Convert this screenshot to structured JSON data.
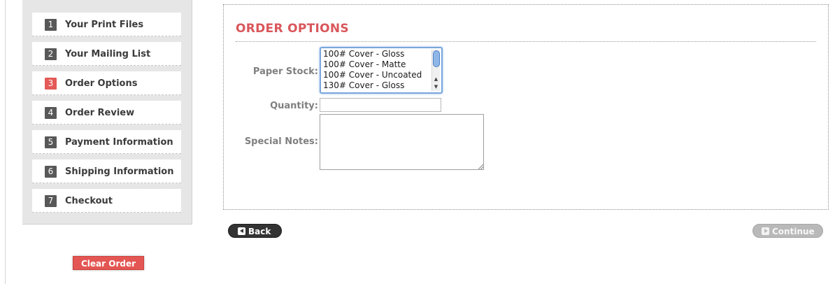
{
  "sidebar": {
    "steps": [
      {
        "num": "1",
        "label": "Your Print Files"
      },
      {
        "num": "2",
        "label": "Your Mailing List"
      },
      {
        "num": "3",
        "label": "Order Options"
      },
      {
        "num": "4",
        "label": "Order Review"
      },
      {
        "num": "5",
        "label": "Payment Information"
      },
      {
        "num": "6",
        "label": "Shipping Information"
      },
      {
        "num": "7",
        "label": "Checkout"
      }
    ],
    "active_step": 3,
    "clear_order_label": "Clear Order"
  },
  "main": {
    "title": "ORDER OPTIONS",
    "paper_stock": {
      "label": "Paper Stock:",
      "options": [
        "100# Cover - Gloss",
        "100# Cover - Matte",
        "100# Cover - Uncoated",
        "130# Cover - Gloss"
      ]
    },
    "quantity": {
      "label": "Quantity:",
      "value": ""
    },
    "special_notes": {
      "label": "Special Notes:",
      "value": ""
    }
  },
  "nav": {
    "back_label": "Back",
    "continue_label": "Continue"
  },
  "colors": {
    "accent": "#e35a57",
    "title": "#d9565b",
    "step_badge": "#585858",
    "focus_border": "#7aa6dc"
  },
  "icons": {
    "back": "triangle-left-icon",
    "continue": "triangle-right-icon"
  }
}
